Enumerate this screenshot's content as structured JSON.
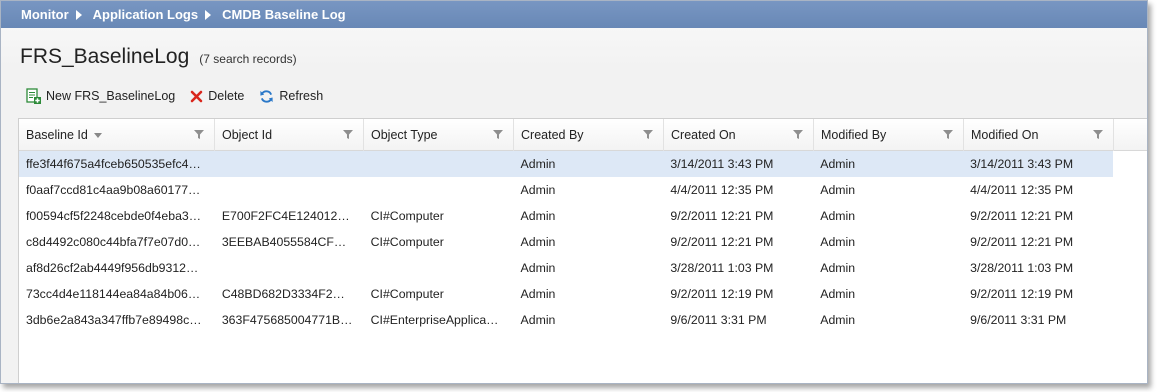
{
  "breadcrumb": {
    "items": [
      "Monitor",
      "Application Logs"
    ],
    "current": "CMDB Baseline Log"
  },
  "page": {
    "title": "FRS_BaselineLog",
    "record_count": "(7 search records)"
  },
  "toolbar": {
    "new_label": "New FRS_BaselineLog",
    "delete_label": "Delete",
    "refresh_label": "Refresh"
  },
  "icons": {
    "new": "new-record-icon",
    "delete": "delete-x-icon",
    "refresh": "refresh-icon",
    "filter": "filter-funnel-icon",
    "sort": "sort-descending-icon"
  },
  "colors": {
    "header_bar": "#6e8fbd",
    "selected_row": "#dde8f6",
    "delete_red": "#d9261c",
    "refresh_blue": "#2a78c8",
    "new_green": "#2e8b3a"
  },
  "grid": {
    "columns": [
      "Baseline Id",
      "Object Id",
      "Object Type",
      "Created By",
      "Created On",
      "Modified By",
      "Modified On"
    ],
    "rows": [
      [
        "ffe3f44f675a4fceb650535efc4…",
        "",
        "",
        "Admin",
        "3/14/2011 3:43 PM",
        "Admin",
        "3/14/2011 3:43 PM"
      ],
      [
        "f0aaf7ccd81c4aa9b08a60177…",
        "",
        "",
        "Admin",
        "4/4/2011 12:35 PM",
        "Admin",
        "4/4/2011 12:35 PM"
      ],
      [
        "f00594cf5f2248cebde0f4eba3…",
        "E700F2FC4E124012…",
        "CI#Computer",
        "Admin",
        "9/2/2011 12:21 PM",
        "Admin",
        "9/2/2011 12:21 PM"
      ],
      [
        "c8d4492c080c44bfa7f7e07d0…",
        "3EEBAB4055584CF…",
        "CI#Computer",
        "Admin",
        "9/2/2011 12:21 PM",
        "Admin",
        "9/2/2011 12:21 PM"
      ],
      [
        "af8d26cf2ab4449f956db9312…",
        "",
        "",
        "Admin",
        "3/28/2011 1:03 PM",
        "Admin",
        "3/28/2011 1:03 PM"
      ],
      [
        "73cc4d4e118144ea84a84b06…",
        "C48BD682D3334F2…",
        "CI#Computer",
        "Admin",
        "9/2/2011 12:19 PM",
        "Admin",
        "9/2/2011 12:19 PM"
      ],
      [
        "3db6e2a843a347ffb7e89498c…",
        "363F475685004771B…",
        "CI#EnterpriseApplica…",
        "Admin",
        "9/6/2011 3:31 PM",
        "Admin",
        "9/6/2011 3:31 PM"
      ]
    ]
  }
}
